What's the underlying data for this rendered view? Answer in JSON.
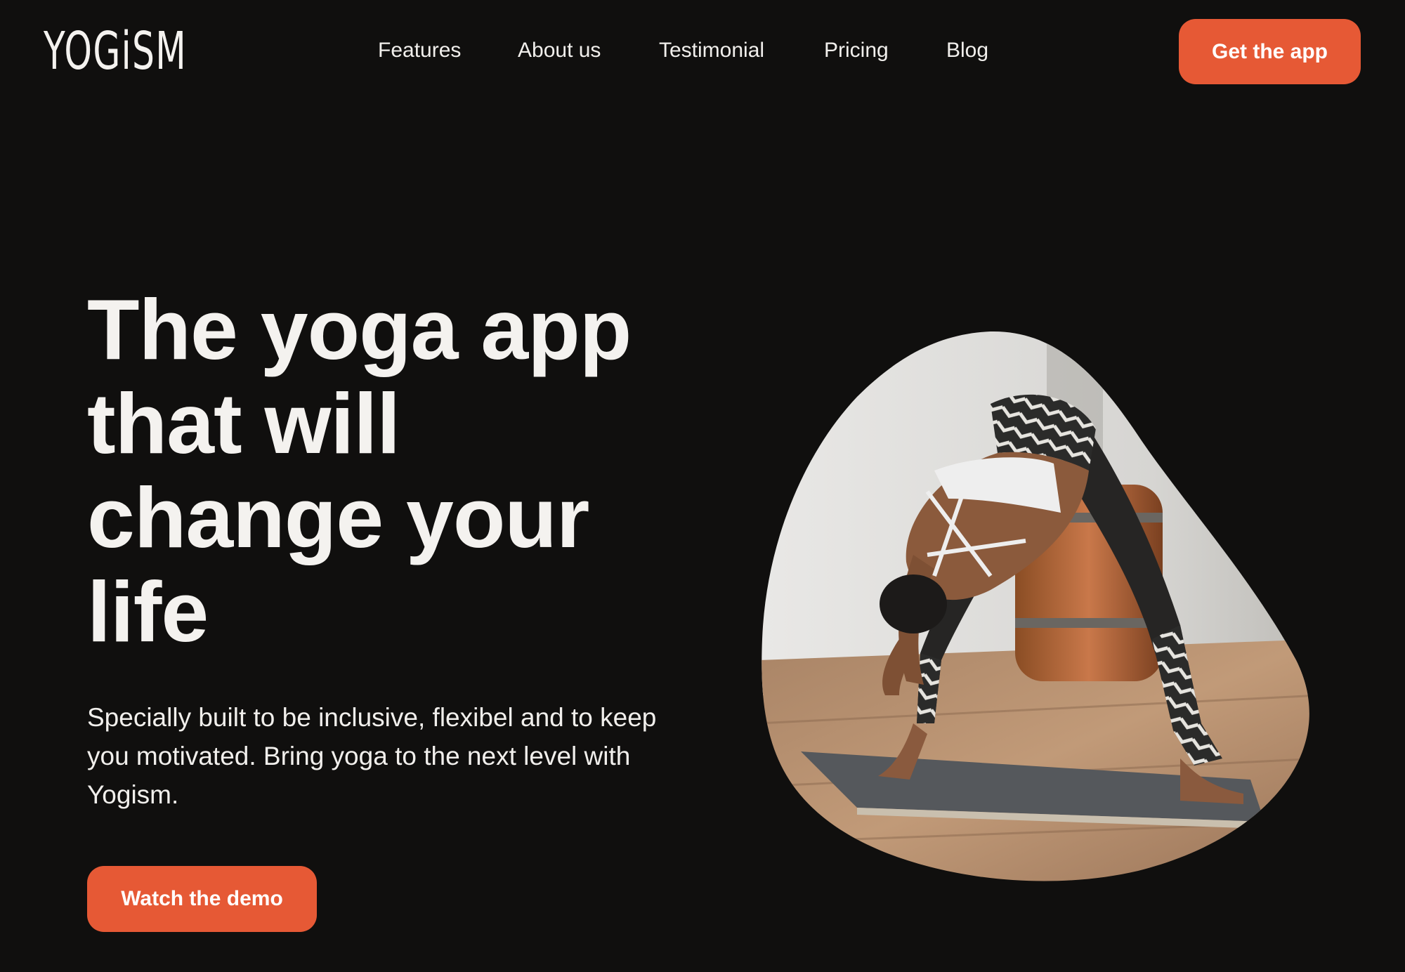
{
  "brand": {
    "logo": "YOGiSM"
  },
  "nav": {
    "items": [
      {
        "label": "Features"
      },
      {
        "label": "About us"
      },
      {
        "label": "Testimonial"
      },
      {
        "label": "Pricing"
      },
      {
        "label": "Blog"
      }
    ]
  },
  "header": {
    "cta_label": "Get the app"
  },
  "hero": {
    "title": "The yoga app that will change your life",
    "subtitle": "Specially built to be inclusive, flexibel and to keep you motivated. Bring yoga to the next level with Yogism.",
    "cta_label": "Watch the demo"
  },
  "colors": {
    "background": "#100f0e",
    "accent": "#e65935",
    "text": "#f4f2ef"
  }
}
